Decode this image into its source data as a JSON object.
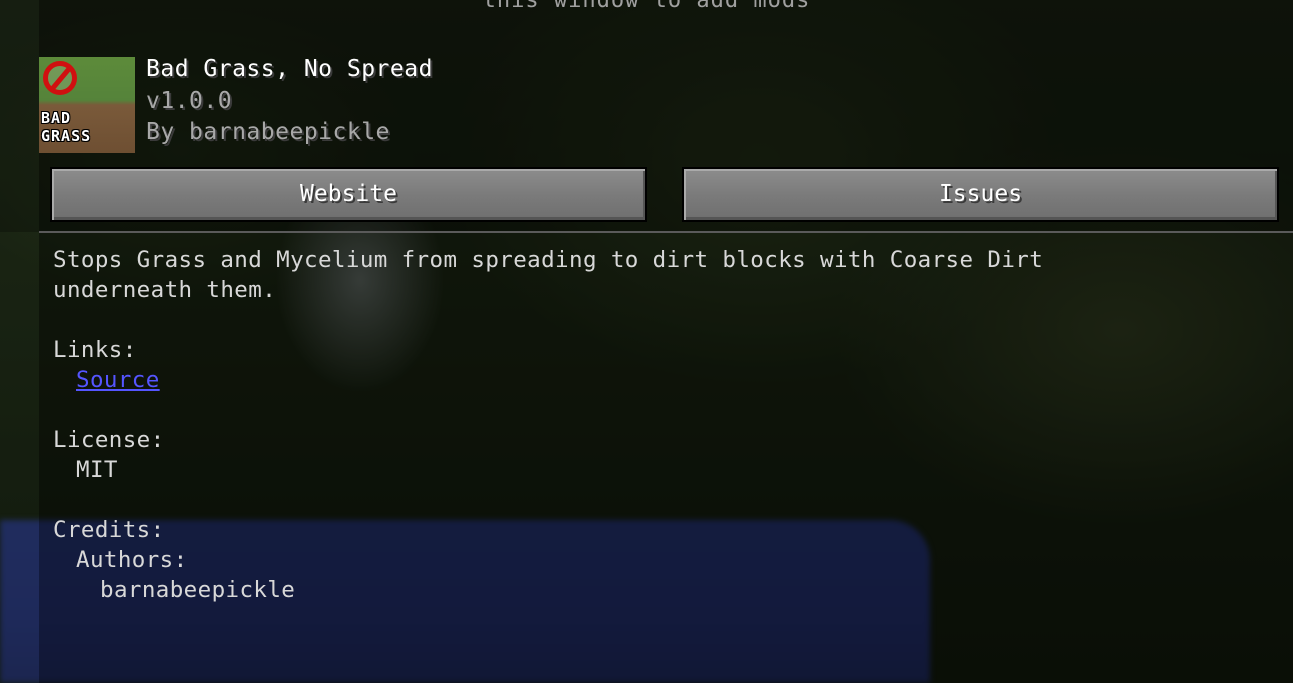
{
  "top_hint": "this window to add mods",
  "mod": {
    "icon_text_line1": "BAD",
    "icon_text_line2": "GRASS",
    "name": "Bad Grass, No Spread",
    "version": "v1.0.0",
    "author": "By barnabeepickle"
  },
  "buttons": {
    "website": "Website",
    "issues": "Issues"
  },
  "description": {
    "line1": "Stops Grass and Mycelium from spreading to dirt blocks with Coarse Dirt",
    "line2": "underneath them."
  },
  "links": {
    "heading": "Links:",
    "source": "Source"
  },
  "license": {
    "heading": "License:",
    "value": "MIT"
  },
  "credits": {
    "heading": "Credits:",
    "authors_heading": "Authors:",
    "author_name": "barnabeepickle"
  },
  "colors": {
    "link": "#5555ff",
    "water": "#2d3f8c"
  }
}
